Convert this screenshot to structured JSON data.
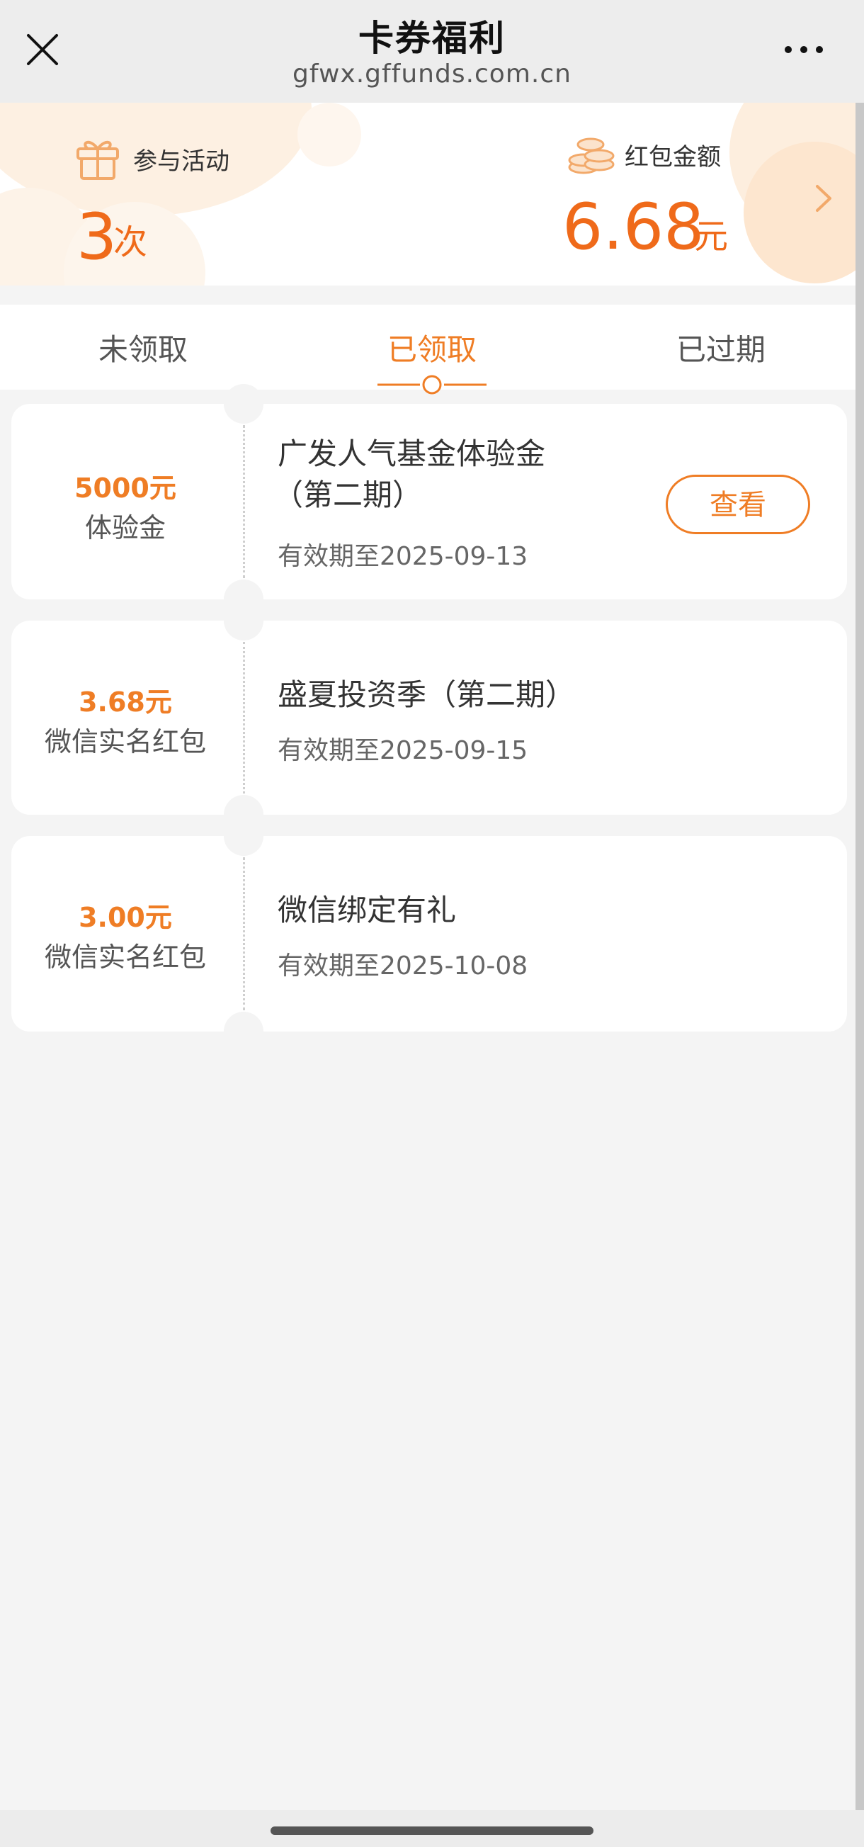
{
  "nav": {
    "title": "卡券福利",
    "url": "gfwx.gffunds.com.cn",
    "close_icon": "close-icon",
    "more_icon": "more-dots-icon"
  },
  "summary": {
    "participation": {
      "label": "参与活动",
      "value": "3",
      "unit": "次",
      "icon": "gift-icon"
    },
    "red_packet": {
      "label": "红包金额",
      "value": "6.68",
      "unit": "元",
      "icon": "coins-icon"
    },
    "arrow_icon": "chevron-right-icon"
  },
  "tabs": [
    {
      "label": "未领取",
      "active": false
    },
    {
      "label": "已领取",
      "active": true
    },
    {
      "label": "已过期",
      "active": false
    }
  ],
  "coupons": [
    {
      "amount": "5000元",
      "kind": "体验金",
      "title_line1": "广发人气基金体验金",
      "title_line2": "（第二期）",
      "expiry": "有效期至2025-09-13",
      "button": "查看"
    },
    {
      "amount": "3.68元",
      "kind": "微信实名红包",
      "title_line1": "盛夏投资季（第二期）",
      "expiry": "有效期至2025-09-15"
    },
    {
      "amount": "3.00元",
      "kind": "微信实名红包",
      "title_line1": "微信绑定有礼",
      "expiry": "有效期至2025-10-08"
    }
  ],
  "colors": {
    "accent": "#ef7d25",
    "accent_dark": "#ef6a1a",
    "background": "#f4f4f4",
    "nav_background": "#ededed"
  }
}
